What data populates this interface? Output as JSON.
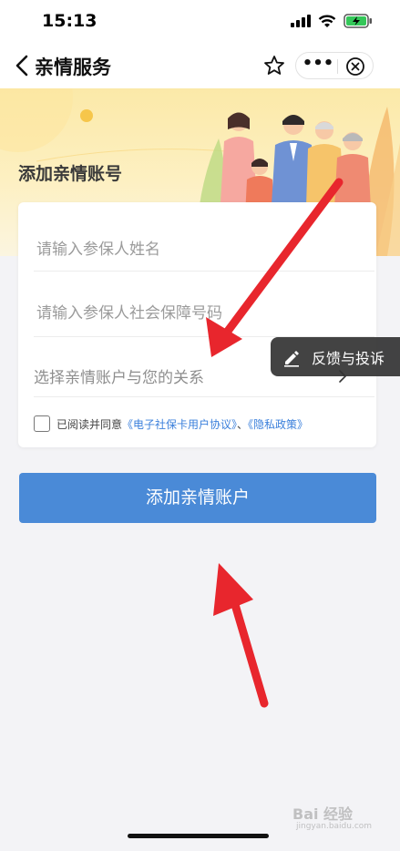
{
  "status_bar": {
    "time": "15:13",
    "icons": [
      "signal-icon",
      "wifi-icon",
      "battery-charging-icon"
    ]
  },
  "nav": {
    "back_icon": "chevron-left-icon",
    "title": "亲情服务",
    "star_icon": "star-outline-icon",
    "more_label": "•••",
    "close_icon": "circle-close-icon"
  },
  "banner": {
    "title": "添加亲情账号",
    "illustration": "family-illustration"
  },
  "form": {
    "name_placeholder": "请输入参保人姓名",
    "id_placeholder": "请输入参保人社会保障号码",
    "relation_placeholder": "选择亲情账户与您的关系",
    "relation_icon": "chevron-right-icon",
    "agree_prefix": "已阅读并同意",
    "agree_link1": "《电子社保卡用户协议》",
    "agree_sep": "、",
    "agree_link2": "《隐私政策》"
  },
  "feedback": {
    "label": "反馈与投诉",
    "icon": "edit-pen-icon"
  },
  "submit_label": "添加亲情账户",
  "watermark": {
    "text": "Bai 经验",
    "sub": "jingyan.baidu.com"
  },
  "colors": {
    "accent": "#4a8ad7",
    "link": "#3a7fdb",
    "annotation_arrow": "#e8262d"
  }
}
